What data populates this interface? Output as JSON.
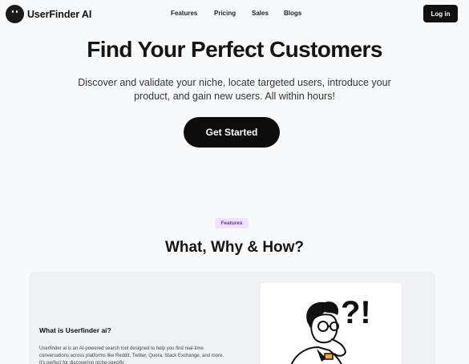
{
  "nav": {
    "brand": "UserFinder AI",
    "items": [
      {
        "label": "Features"
      },
      {
        "label": "Pricing"
      },
      {
        "label": "Sales"
      },
      {
        "label": "Blogs"
      }
    ],
    "login_label": "Log in"
  },
  "hero": {
    "title": "Find Your Perfect Customers",
    "subtitle": "Discover and validate your niche, locate targeted users, introduce your product, and gain new users. All within hours!",
    "cta_label": "Get Started"
  },
  "features": {
    "badge": "Features",
    "title": "What, Why & How?",
    "card": {
      "heading": "What is Userfinder ai?",
      "text": "Userfinder ai is an AI-powered search tool designed to help you find real-time conversations across platforms like Reddit, Twitter, Quora, Stack Exchange, and more. It's perfect for discovering niche-specific",
      "illustration_marks": "?!"
    }
  },
  "colors": {
    "background": "#f8f9fb",
    "primary": "#111111",
    "badge_bg": "#efe3fb",
    "badge_text": "#6b2aa8",
    "card_bg": "#eef0f3"
  }
}
